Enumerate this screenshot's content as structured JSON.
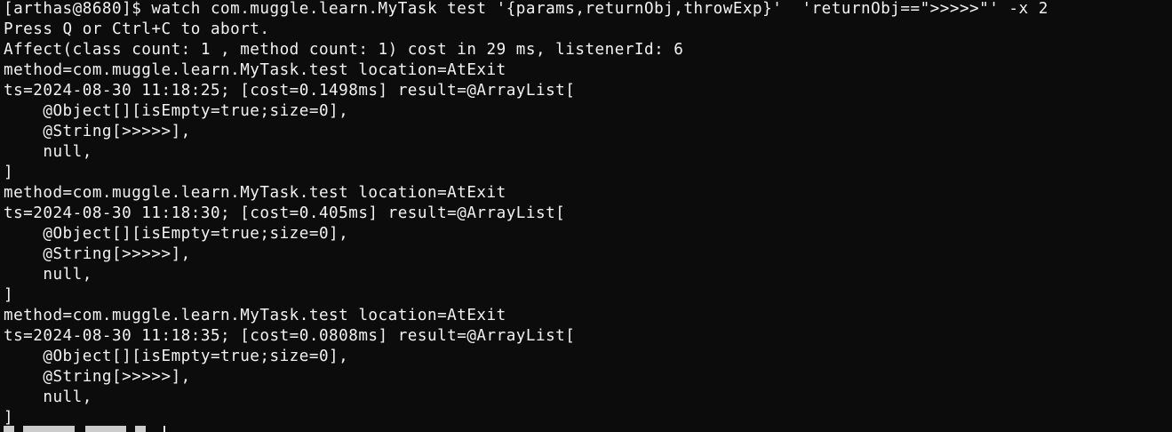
{
  "terminal": {
    "lines": [
      "[arthas@8680]$ watch com.muggle.learn.MyTask test '{params,returnObj,throwExp}'  'returnObj==\">>>>>\"' -x 2",
      "Press Q or Ctrl+C to abort.",
      "Affect(class count: 1 , method count: 1) cost in 29 ms, listenerId: 6",
      "method=com.muggle.learn.MyTask.test location=AtExit",
      "ts=2024-08-30 11:18:25; [cost=0.1498ms] result=@ArrayList[",
      "    @Object[][isEmpty=true;size=0],",
      "    @String[>>>>>],",
      "    null,",
      "]",
      "method=com.muggle.learn.MyTask.test location=AtExit",
      "ts=2024-08-30 11:18:30; [cost=0.405ms] result=@ArrayList[",
      "    @Object[][isEmpty=true;size=0],",
      "    @String[>>>>>],",
      "    null,",
      "]",
      "method=com.muggle.learn.MyTask.test location=AtExit",
      "ts=2024-08-30 11:18:35; [cost=0.0808ms] result=@ArrayList[",
      "    @Object[][isEmpty=true;size=0],",
      "    @String[>>>>>],",
      "    null,",
      "]"
    ]
  },
  "colors": {
    "background": "#0c0c0c",
    "foreground": "#f2f2f2"
  }
}
